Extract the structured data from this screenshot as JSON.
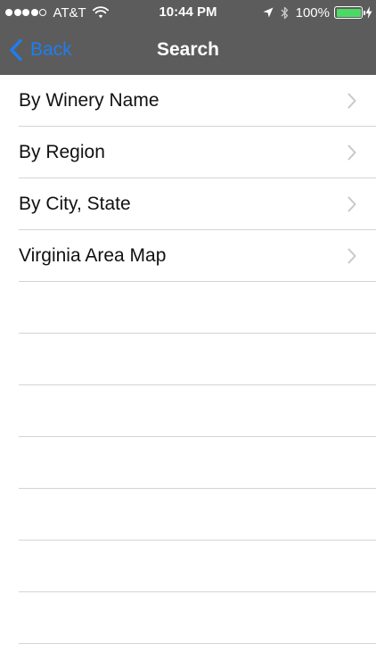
{
  "status_bar": {
    "signal_strength": 4,
    "signal_max": 5,
    "carrier": "AT&T",
    "time": "10:44 PM",
    "battery_text": "100%",
    "battery_level": 1.0,
    "icons": [
      "wifi-icon",
      "location-icon",
      "bluetooth-icon",
      "battery-icon",
      "charging-icon"
    ]
  },
  "nav_bar": {
    "back_label": "Back",
    "title": "Search"
  },
  "colors": {
    "bar_background": "#5c5c5c",
    "back_tint": "#1e7ef0",
    "battery_fill": "#4cd964",
    "separator": "#d4d4d8",
    "chevron": "#c7c7cc"
  },
  "menu": {
    "items": [
      {
        "label": "By Winery Name"
      },
      {
        "label": "By Region"
      },
      {
        "label": "By City, State"
      },
      {
        "label": "Virginia Area Map"
      }
    ]
  }
}
